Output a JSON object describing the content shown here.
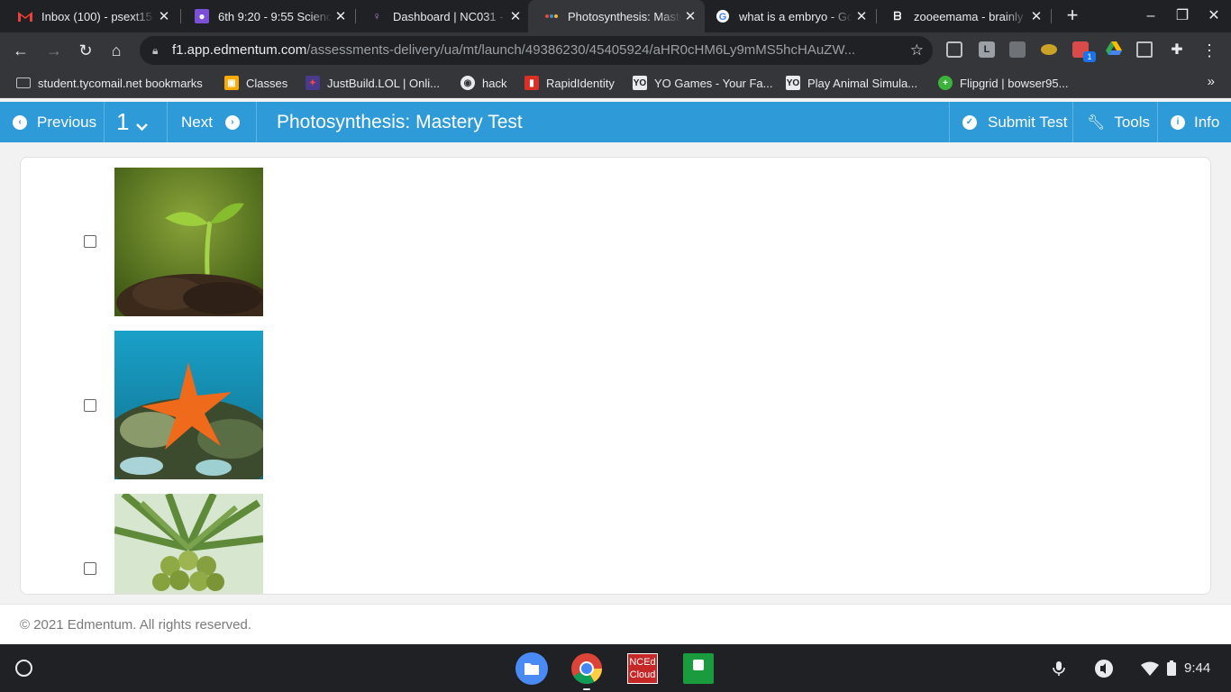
{
  "browser": {
    "tabs": [
      {
        "title": "Inbox (100) - psext15",
        "icon": "gmail-icon"
      },
      {
        "title": "6th 9:20 - 9:55 Science",
        "icon": "classroom-icon"
      },
      {
        "title": "Dashboard | NC031 - ",
        "icon": "bulb-icon"
      },
      {
        "title": "Photosynthesis: Mastery Test",
        "icon": "edmentum-icon"
      },
      {
        "title": "what is a embryo - Google",
        "icon": "google-icon"
      },
      {
        "title": "zooeemama - brainly",
        "icon": "brainly-icon"
      }
    ],
    "url_host": "f1.app.edmentum.com",
    "url_path": "/assessments-delivery/ua/mt/launch/49386230/45405924/aHR0cHM6Ly9mMS5hcHAuZW...",
    "bookmarks": [
      {
        "label": "student.tycomail.net bookmarks",
        "icon": "folder-icon"
      },
      {
        "label": "Classes",
        "icon": "classroom-icon"
      },
      {
        "label": "JustBuild.LOL | Onli...",
        "icon": "justbuild-icon"
      },
      {
        "label": "hack",
        "icon": "globe-icon"
      },
      {
        "label": "RapidIdentity",
        "icon": "rapididentity-icon"
      },
      {
        "label": "YO Games - Your Fa...",
        "icon": "yo-icon"
      },
      {
        "label": "Play Animal Simula...",
        "icon": "yo-icon"
      },
      {
        "label": "Flipgrid | bowser95...",
        "icon": "flipgrid-icon"
      }
    ],
    "bookmarks_more": "»"
  },
  "app": {
    "previous_label": "Previous",
    "question_number": "1",
    "next_label": "Next",
    "title": "Photosynthesis: Mastery Test",
    "submit_label": "Submit Test",
    "tools_label": "Tools",
    "info_label": "Info"
  },
  "options": [
    {
      "image": "seedling-sprouting-from-soil"
    },
    {
      "image": "orange-starfish-on-coral-reef"
    },
    {
      "image": "coconut-palm-with-coconuts"
    }
  ],
  "footer": {
    "copyright": "© 2021 Edmentum. All rights reserved."
  },
  "shelf": {
    "apps": [
      "files-icon",
      "chrome-icon",
      "nced-cloud-icon",
      "accelerated-math-icon"
    ],
    "nced_label_1": "NCEd",
    "nced_label_2": "Cloud",
    "time": "9:44"
  },
  "colors": {
    "header_blue": "#2e9ad8"
  }
}
